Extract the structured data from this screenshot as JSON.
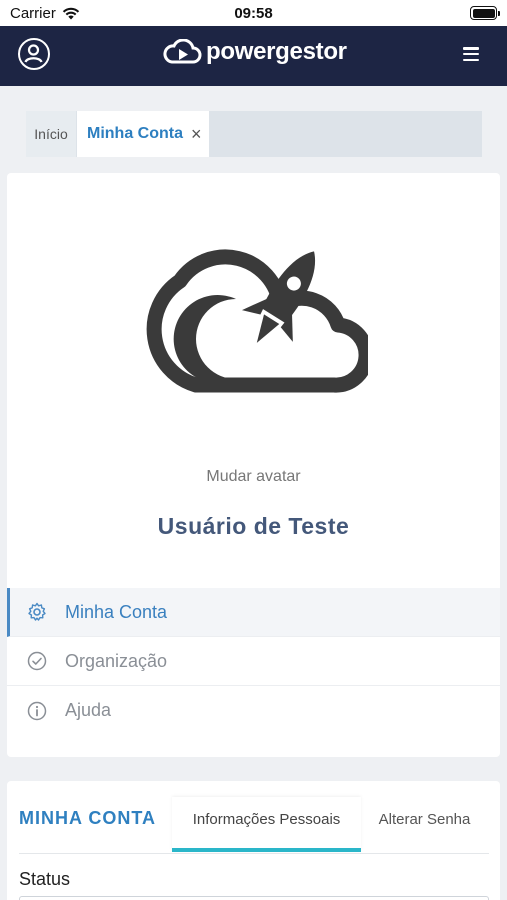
{
  "statusbar": {
    "carrier": "Carrier",
    "time": "09:58"
  },
  "navbar": {
    "brand": "powergestor"
  },
  "tabs": {
    "home": "Início",
    "account": "Minha Conta",
    "close": "×"
  },
  "profile": {
    "change_avatar": "Mudar avatar",
    "user_name": "Usuário de Teste"
  },
  "menu": {
    "items": [
      {
        "label": "Minha Conta",
        "icon": "gear-icon",
        "active": true
      },
      {
        "label": "Organização",
        "icon": "check-circle-icon",
        "active": false
      },
      {
        "label": "Ajuda",
        "icon": "info-icon",
        "active": false
      }
    ]
  },
  "account": {
    "title": "MINHA CONTA",
    "tabs": [
      "Informações Pessoais",
      "Alterar Senha"
    ],
    "status_label": "Status"
  },
  "colors": {
    "navbar": "#1d2544",
    "accent": "#2f80c0",
    "tab_underline": "#2ab6c9"
  }
}
